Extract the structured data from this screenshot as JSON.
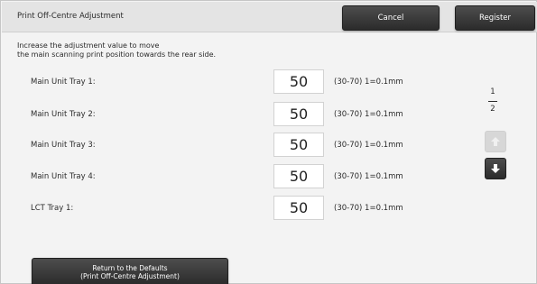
{
  "header": {
    "title": "Print Off-Centre Adjustment",
    "cancel_label": "Cancel",
    "register_label": "Register"
  },
  "instruction": {
    "line1": "Increase the adjustment value to move",
    "line2": "the main scanning print position towards the rear side."
  },
  "rows": [
    {
      "label": "Main Unit Tray 1:",
      "value": "50",
      "range": "(30-70) 1=0.1mm"
    },
    {
      "label": "Main Unit Tray 2:",
      "value": "50",
      "range": "(30-70) 1=0.1mm"
    },
    {
      "label": "Main Unit Tray 3:",
      "value": "50",
      "range": "(30-70) 1=0.1mm"
    },
    {
      "label": "Main Unit Tray 4:",
      "value": "50",
      "range": "(30-70) 1=0.1mm"
    },
    {
      "label": "LCT Tray 1:",
      "value": "50",
      "range": "(30-70) 1=0.1mm"
    }
  ],
  "pager": {
    "current": "1",
    "total": "2",
    "up_icon": "arrow-up-icon",
    "down_icon": "arrow-down-icon"
  },
  "footer": {
    "defaults_line1": "Return to the Defaults",
    "defaults_line2": "(Print Off-Centre Adjustment)"
  }
}
